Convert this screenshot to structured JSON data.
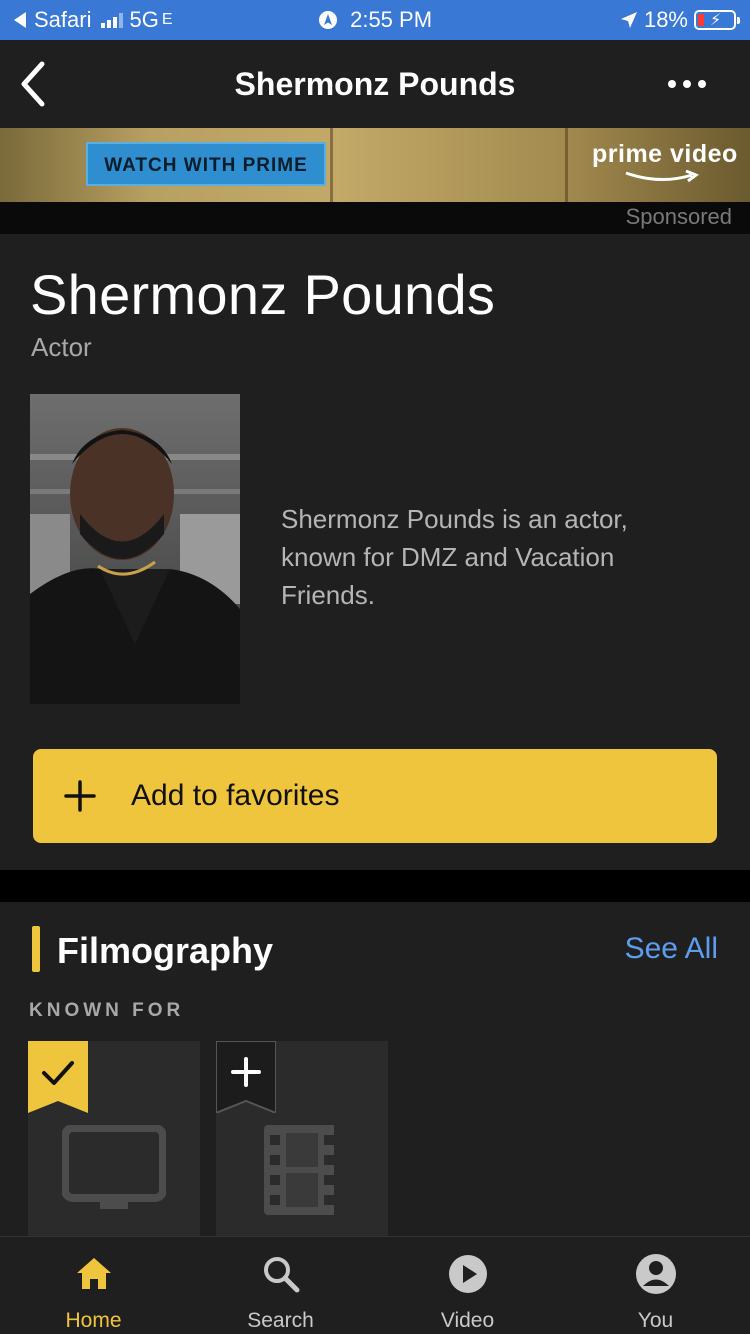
{
  "status_bar": {
    "back_app": "Safari",
    "network": "5G",
    "network_suffix": "E",
    "time": "2:55 PM",
    "battery": "18%"
  },
  "nav": {
    "title": "Shermonz Pounds",
    "back_icon": "chevron-left-icon",
    "more_icon": "ellipsis-icon"
  },
  "ad": {
    "cta_label": "WATCH WITH PRIME",
    "brand": "prime video",
    "sponsored_label": "Sponsored"
  },
  "person": {
    "name": "Shermonz Pounds",
    "role": "Actor",
    "bio": "Shermonz Pounds is an actor, known for DMZ and Vacation Friends."
  },
  "favorites_button": {
    "label": "Add to favorites",
    "icon": "plus-icon"
  },
  "filmography": {
    "heading": "Filmography",
    "see_all": "See All",
    "known_for_label": "KNOWN FOR",
    "items": [
      {
        "icon": "tv-icon",
        "watchlisted": true
      },
      {
        "icon": "film-icon",
        "watchlisted": false
      }
    ]
  },
  "tab_bar": {
    "tabs": [
      {
        "label": "Home",
        "icon": "home-icon",
        "active": true
      },
      {
        "label": "Search",
        "icon": "search-icon",
        "active": false
      },
      {
        "label": "Video",
        "icon": "play-icon",
        "active": false
      },
      {
        "label": "You",
        "icon": "user-icon",
        "active": false
      }
    ]
  },
  "colors": {
    "accent": "#f0c53e",
    "link": "#5c9df0",
    "surface": "#1f1f1f",
    "status_bar": "#3a78d6"
  }
}
